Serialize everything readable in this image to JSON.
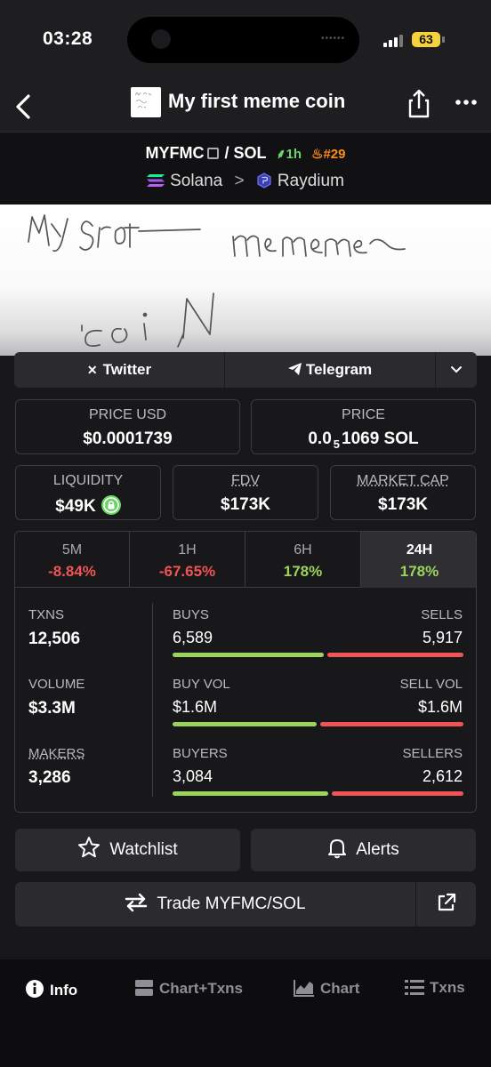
{
  "status_bar": {
    "time": "03:28",
    "battery": "63"
  },
  "header": {
    "title": "My first meme coin",
    "logo_text": "My first meme coin"
  },
  "pair": {
    "base": "MYFMC",
    "separator": "/",
    "quote": "SOL",
    "age": "1h",
    "rank": "#29",
    "chain": "Solana",
    "chevron": ">",
    "dex": "Raydium"
  },
  "banner": {
    "handwritten_text": "My first meme coin"
  },
  "social": {
    "twitter": "Twitter",
    "telegram": "Telegram"
  },
  "price_cards": [
    {
      "label": "PRICE USD",
      "value": "$0.0001739"
    },
    {
      "label": "PRICE",
      "value_prefix": "0.0",
      "value_sub": "5",
      "value_suffix": "1069 SOL"
    }
  ],
  "metric_cards": [
    {
      "label": "LIQUIDITY",
      "value": "$49K"
    },
    {
      "label": "FDV",
      "value": "$173K"
    },
    {
      "label": "MARKET CAP",
      "value": "$173K"
    }
  ],
  "timeframes": [
    {
      "label": "5M",
      "change": "-8.84%",
      "direction": "down"
    },
    {
      "label": "1H",
      "change": "-67.65%",
      "direction": "down"
    },
    {
      "label": "6H",
      "change": "178%",
      "direction": "up"
    },
    {
      "label": "24H",
      "change": "178%",
      "direction": "up",
      "selected": true
    }
  ],
  "stats": {
    "txns": {
      "label": "TXNS",
      "value": "12,506",
      "left_label": "BUYS",
      "left_value": "6,589",
      "right_label": "SELLS",
      "right_value": "5,917",
      "buy_fraction": 0.527
    },
    "volume": {
      "label": "VOLUME",
      "value": "$3.3M",
      "left_label": "BUY VOL",
      "left_value": "$1.6M",
      "right_label": "SELL VOL",
      "right_value": "$1.6M",
      "buy_fraction": 0.5
    },
    "makers": {
      "label": "MAKERS",
      "value": "3,286",
      "left_label": "BUYERS",
      "left_value": "3,084",
      "right_label": "SELLERS",
      "right_value": "2,612",
      "buy_fraction": 0.541
    }
  },
  "actions": {
    "watchlist": "Watchlist",
    "alerts": "Alerts",
    "trade": "Trade MYFMC/SOL"
  },
  "bottom_nav": [
    {
      "label": "Info",
      "icon": "info-icon",
      "active": true
    },
    {
      "label": "Chart+Txns",
      "icon": "chart-txns-icon"
    },
    {
      "label": "Chart",
      "icon": "chart-icon"
    },
    {
      "label": "Txns",
      "icon": "list-icon"
    }
  ],
  "colors": {
    "background": "#18181b",
    "green": "#9bd45b",
    "red": "#f05454",
    "card_border": "#3a3a40",
    "button": "#2b2b2f"
  }
}
